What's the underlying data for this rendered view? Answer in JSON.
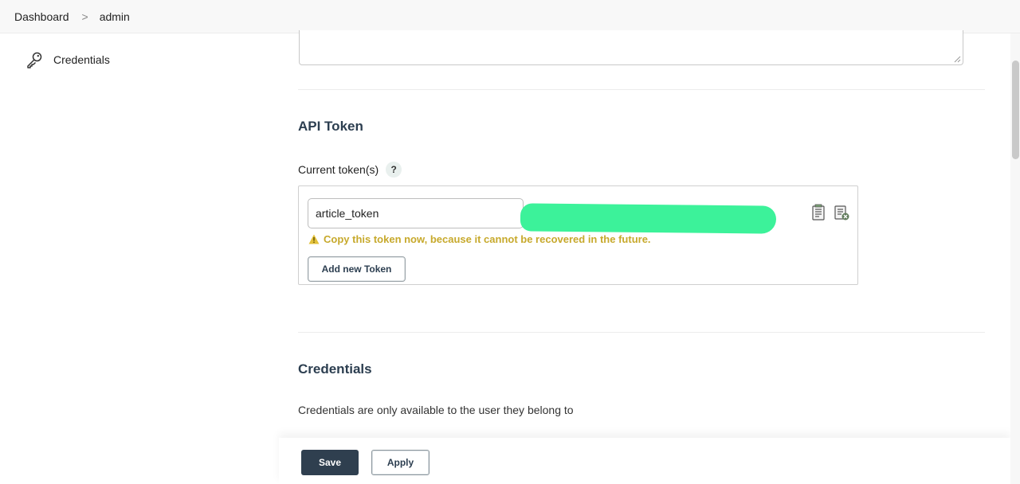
{
  "breadcrumb": {
    "items": [
      {
        "label": "Dashboard"
      },
      {
        "label": "admin"
      }
    ],
    "separator": ">"
  },
  "sidebar": {
    "items": [
      {
        "label": "Credentials",
        "icon": "key-icon"
      }
    ]
  },
  "api_token": {
    "title": "API Token",
    "current_tokens_label": "Current token(s)",
    "help_label": "?",
    "token_name_value": "article_token",
    "warning": "Copy this token now, because it cannot be recovered in the future.",
    "add_button_label": "Add new Token",
    "actions": [
      "copy-token-icon",
      "revoke-token-icon"
    ]
  },
  "credentials": {
    "title": "Credentials",
    "description": "Credentials are only available to the user they belong to"
  },
  "footer": {
    "save_label": "Save",
    "apply_label": "Apply"
  },
  "colors": {
    "primary_button": "#2f3f4f",
    "warning_text": "#c7a92c",
    "redaction": "#3cf29a",
    "heading": "#2c3e50"
  }
}
